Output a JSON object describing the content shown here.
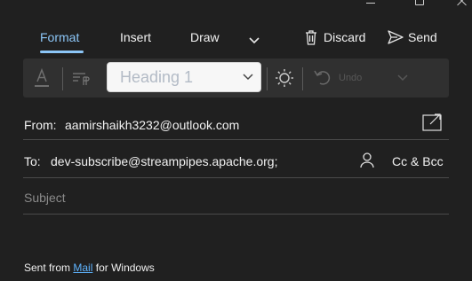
{
  "tabs": [
    {
      "label": "Format"
    },
    {
      "label": "Insert"
    },
    {
      "label": "Draw"
    }
  ],
  "actions": {
    "discard": "Discard",
    "send": "Send"
  },
  "toolbar": {
    "style_value": "Heading 1",
    "undo_label": "Undo"
  },
  "message": {
    "from_label": "From:",
    "from_value": "aamirshaikh3232@outlook.com",
    "to_label": "To:",
    "to_value": "dev-subscribe@streampipes.apache.org;",
    "cc_bcc": "Cc & Bcc",
    "subject_placeholder": "Subject"
  },
  "signature": {
    "prefix": "Sent from",
    "link": "Mail",
    "suffix": "for Windows"
  },
  "colors": {
    "accent": "#8cc6f7",
    "background": "#202020",
    "toolbar": "#303030",
    "link": "#5fb4ff"
  }
}
